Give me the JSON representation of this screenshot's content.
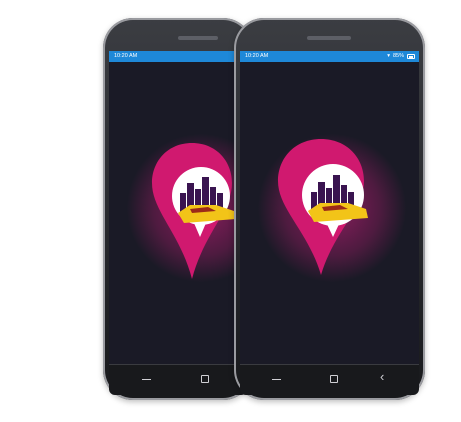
{
  "phones": [
    {
      "status_time": "10:20 AM",
      "battery": "",
      "nav": [
        "menu",
        "home"
      ]
    },
    {
      "status_time": "10:20 AM",
      "battery": "85%",
      "nav": [
        "menu",
        "home",
        "back"
      ]
    }
  ],
  "icons": {
    "back": "‹"
  },
  "colors": {
    "screen_bg": "#1a1a26",
    "statusbar": "#1e88d8",
    "pin": "#e0197e",
    "building": "#3a1450",
    "car": "#f2c418"
  }
}
